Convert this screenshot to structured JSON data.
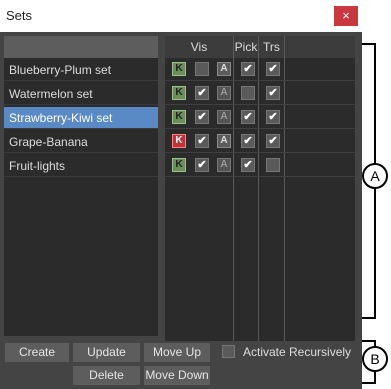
{
  "window": {
    "title": "Sets",
    "close_glyph": "×"
  },
  "list": {
    "items": [
      {
        "label": "Blueberry-Plum set",
        "selected": false
      },
      {
        "label": "Watermelon set",
        "selected": false
      },
      {
        "label": "Strawberry-Kiwi set",
        "selected": true
      },
      {
        "label": "Grape-Banana",
        "selected": false
      },
      {
        "label": "Fruit-lights",
        "selected": false
      }
    ]
  },
  "columns": {
    "vis": "Vis",
    "pick": "Pick",
    "trs": "Trs"
  },
  "rows": [
    {
      "k": "K",
      "k_red": false,
      "vis": false,
      "a": "A",
      "a_on": true,
      "pick": true,
      "trs": true
    },
    {
      "k": "K",
      "k_red": false,
      "vis": true,
      "a": "A",
      "a_on": false,
      "pick": false,
      "trs": true
    },
    {
      "k": "K",
      "k_red": false,
      "vis": true,
      "a": "A",
      "a_on": false,
      "pick": true,
      "trs": true
    },
    {
      "k": "K",
      "k_red": true,
      "vis": true,
      "a": "A",
      "a_on": true,
      "pick": true,
      "trs": true
    },
    {
      "k": "K",
      "k_red": false,
      "vis": true,
      "a": "A",
      "a_on": false,
      "pick": true,
      "trs": false
    }
  ],
  "buttons": {
    "create": "Create",
    "update": "Update",
    "move_up": "Move Up",
    "delete": "Delete",
    "move_down": "Move Down"
  },
  "activate_recursively": {
    "label": "Activate Recursively",
    "checked": false
  },
  "callouts": {
    "a": "A",
    "b": "B"
  },
  "colors": {
    "selection": "#5a8ac6",
    "close": "#c9373f",
    "key_green": "#6b8e5a",
    "key_red": "#c0333b"
  }
}
